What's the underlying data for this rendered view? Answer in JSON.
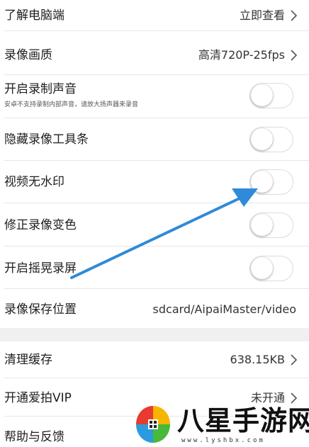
{
  "settings": {
    "rows": [
      {
        "title": "了解电脑端",
        "value": "立即查看",
        "kind": "link"
      },
      {
        "title": "录像画质",
        "value": "高清720P-25fps",
        "kind": "link"
      },
      {
        "title": "开启录制声音",
        "subtitle": "安卓不支持录制内部声音，请放大扬声器来录音",
        "kind": "toggle",
        "on": false
      },
      {
        "title": "隐藏录像工具条",
        "kind": "toggle",
        "on": false
      },
      {
        "title": "视频无水印",
        "kind": "toggle",
        "on": false
      },
      {
        "title": "修正录像变色",
        "kind": "toggle",
        "on": false
      },
      {
        "title": "开启摇晃录屏",
        "kind": "toggle",
        "on": false
      },
      {
        "title": "录像保存位置",
        "value": "sdcard/AipaiMaster/video",
        "kind": "info"
      }
    ],
    "rows2": [
      {
        "title": "清理缓存",
        "value": "638.15KB",
        "kind": "link"
      },
      {
        "title": "开通爱拍VIP",
        "value": "未开通",
        "kind": "link"
      },
      {
        "title": "帮助与反馈",
        "kind": "link"
      }
    ]
  },
  "watermark": {
    "title": "八星手游网",
    "url": "www.lyshbx.com"
  },
  "colors": {
    "arrow": "#2f8ad9",
    "separator": "#f0f0f0",
    "divider": "#e6e6e6",
    "toggle_border": "#dcdcdc"
  },
  "icons": {
    "chevron": "chevron-right-icon",
    "arrow": "annotation-arrow-icon",
    "logo": "bxsyw-logo"
  }
}
